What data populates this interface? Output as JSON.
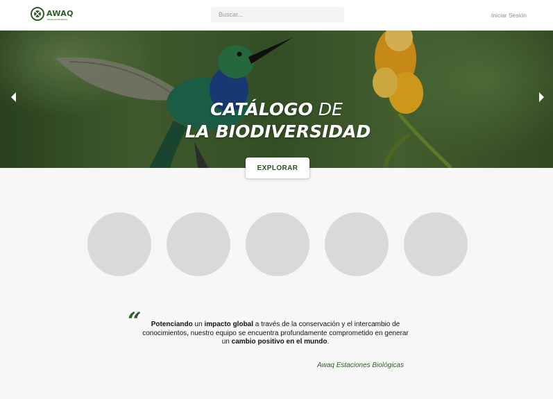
{
  "header": {
    "logo_name": "AWAQ",
    "logo_sub": "Estaciones Biológicas",
    "search_placeholder": "Buscar...",
    "login_label": "Iniciar Sesión"
  },
  "hero": {
    "title_bold": "CATÁLOGO",
    "title_thin": "DE",
    "title_line2": "LA BIODIVERSIDAD",
    "explore_label": "EXPLORAR"
  },
  "categories": [
    "",
    "",
    "",
    "",
    ""
  ],
  "quote": {
    "p1": "Potenciando",
    "p2": " un ",
    "p3": "impacto global",
    "p4": " a través de la conservación y el intercambio de conocimientos, nuestro equipo se encuentra profundamente comprometido en generar un ",
    "p5": "cambio positivo en el mundo",
    "p6": ".",
    "author": "Awaq Estaciones Biológicas"
  },
  "colors": {
    "brand_green": "#2f5d2a",
    "circle_gray": "#d9d9d9"
  }
}
